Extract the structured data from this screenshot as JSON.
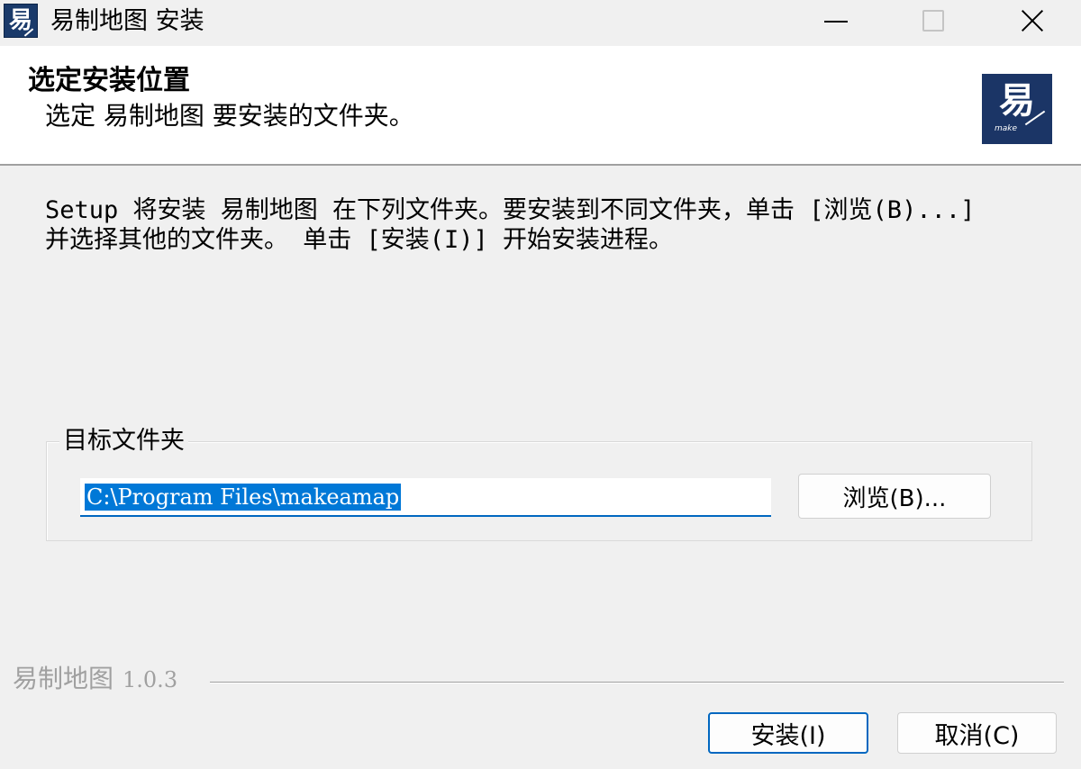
{
  "window": {
    "title": "易制地图 安装",
    "icon": "app-logo-icon"
  },
  "header": {
    "title": "选定安装位置",
    "subtitle": "选定 易制地图 要安装的文件夹。",
    "logo_glyph": "易",
    "logo_tagline": "make"
  },
  "description": "Setup 将安装 易制地图 在下列文件夹。要安装到不同文件夹，单击 [浏览(B)...]\n并选择其他的文件夹。 单击 [安装(I)] 开始安装进程。",
  "destination": {
    "group_label": "目标文件夹",
    "path": "C:\\Program Files\\makeamap",
    "browse_label": "浏览(B)..."
  },
  "footer": {
    "brand": "易制地图",
    "version": "1.0.3",
    "install_label": "安装(I)",
    "cancel_label": "取消(C)"
  },
  "colors": {
    "accent": "#0067c0",
    "selection": "#0078d7",
    "logo_bg": "#1b3566",
    "muted_text": "#a0a0a0"
  }
}
